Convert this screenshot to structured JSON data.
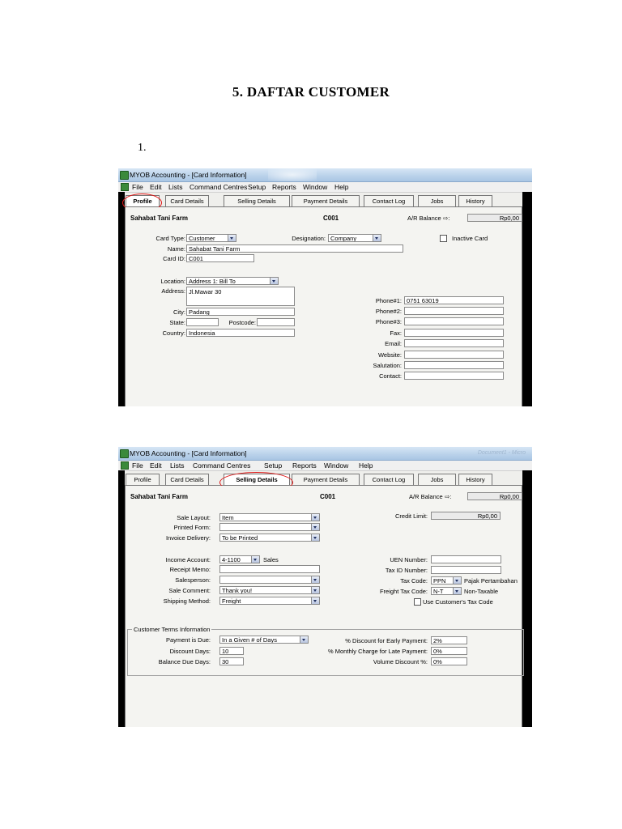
{
  "document": {
    "title": "5. DAFTAR CUSTOMER",
    "list_number": "1."
  },
  "window": {
    "title": "MYOB Accounting - [Card Information]",
    "ghost_title": "Document1 - Micro"
  },
  "menu": [
    "File",
    "Edit",
    "Lists",
    "Command Centres",
    "Setup",
    "Reports",
    "Window",
    "Help"
  ],
  "tabs": [
    "Profile",
    "Card Details",
    "Selling Details",
    "Payment Details",
    "Contact Log",
    "Jobs",
    "History"
  ],
  "header": {
    "name": "Sahabat Tani Farm",
    "card_id": "C001",
    "ar_label": "A/R Balance",
    "ar_value": "Rp0,00"
  },
  "profile": {
    "card_type_label": "Card Type:",
    "card_type": "Customer",
    "designation_label": "Designation:",
    "designation": "Company",
    "inactive_label": "Inactive Card",
    "name_label": "Name:",
    "name": "Sahabat Tani Farm",
    "card_id_label": "Card ID:",
    "card_id": "C001",
    "location_label": "Location:",
    "location": "Address 1:  Bill To",
    "address_label": "Address:",
    "address": "Jl.Mawar 30",
    "city_label": "City:",
    "city": "Padang",
    "state_label": "State:",
    "postcode_label": "Postcode:",
    "country_label": "Country:",
    "country": "Indonesia",
    "phone1_label": "Phone#1:",
    "phone1": "0751 63019",
    "phone2_label": "Phone#2:",
    "phone3_label": "Phone#3:",
    "fax_label": "Fax:",
    "email_label": "Email:",
    "website_label": "Website:",
    "salutation_label": "Salutation:",
    "contact_label": "Contact:"
  },
  "selling": {
    "sale_layout_label": "Sale Layout:",
    "sale_layout": "Item",
    "printed_form_label": "Printed Form:",
    "invoice_delivery_label": "Invoice Delivery:",
    "invoice_delivery": "To be Printed",
    "credit_limit_label": "Credit Limit:",
    "credit_limit": "Rp0,00",
    "income_account_label": "Income Account:",
    "income_account": "4-1100",
    "income_account_name": "Sales",
    "receipt_memo_label": "Receipt Memo:",
    "salesperson_label": "Salesperson:",
    "sale_comment_label": "Sale Comment:",
    "sale_comment": "Thank you!",
    "shipping_method_label": "Shipping Method:",
    "shipping_method": "Freight",
    "uen_label": "UEN Number:",
    "tax_id_label": "Tax ID Number:",
    "tax_code_label": "Tax Code:",
    "tax_code": "PPN",
    "tax_code_name": "Pajak Pertambahan",
    "freight_tax_label": "Freight Tax Code:",
    "freight_tax": "N-T",
    "freight_tax_name": "Non-Taxable",
    "use_customer_tax_label": "Use Customer's Tax Code",
    "terms_title": "Customer Terms Information",
    "payment_due_label": "Payment is Due:",
    "payment_due": "In a Given # of Days",
    "discount_days_label": "Discount Days:",
    "discount_days": "10",
    "balance_due_label": "Balance Due Days:",
    "balance_due": "30",
    "early_discount_label": "% Discount for Early Payment:",
    "early_discount": "2%",
    "late_charge_label": "% Monthly Charge for Late Payment:",
    "late_charge": "0%",
    "volume_discount_label": "Volume Discount %:",
    "volume_discount": "0%"
  }
}
